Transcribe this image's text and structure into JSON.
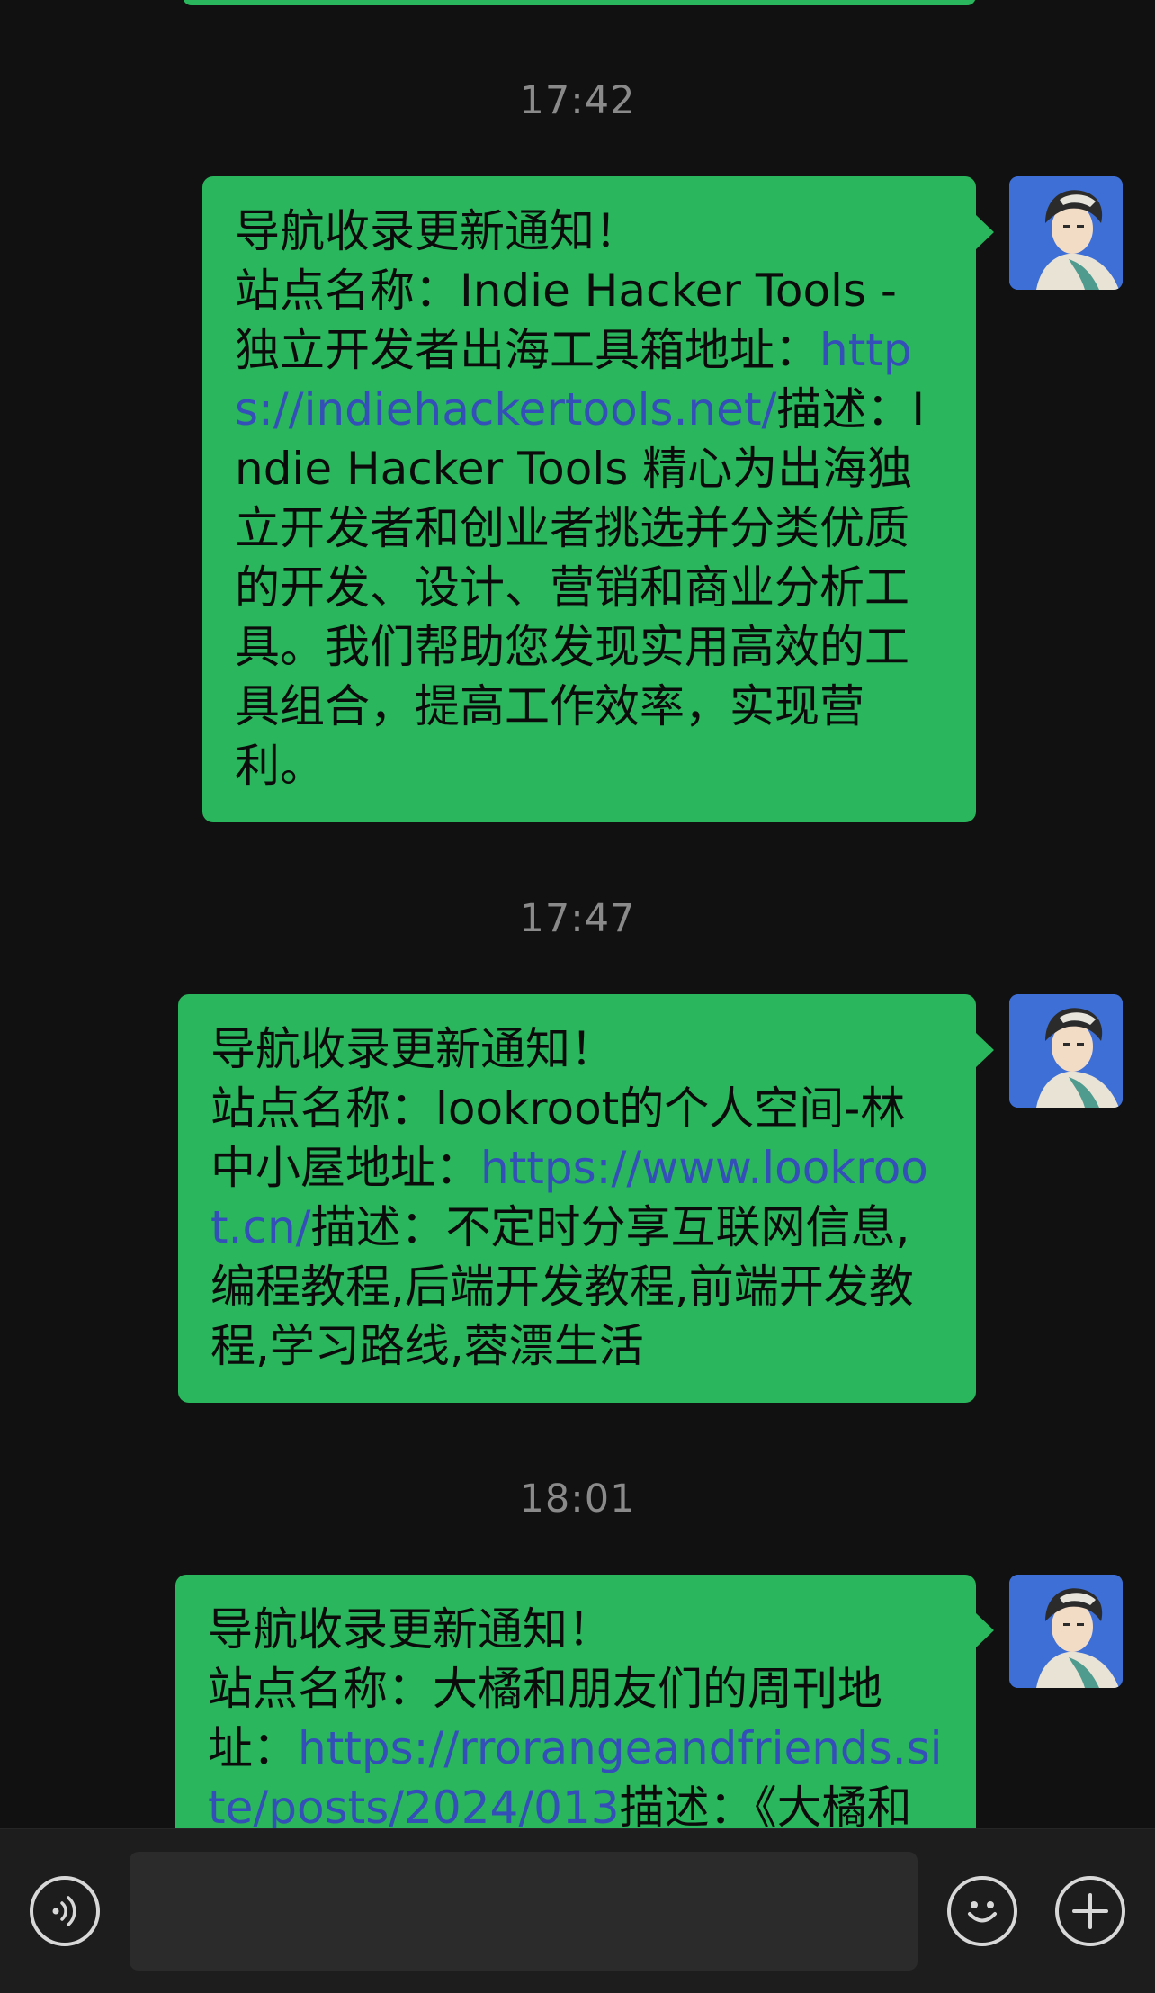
{
  "messages": [
    {
      "time": "17:42",
      "title": "导航收录更新通知！",
      "site_prefix": "站点名称：",
      "site_name": "Indie Hacker Tools - 独立开发者出海工具箱",
      "url_prefix": "地址：",
      "url": "https://indiehackertools.net/",
      "desc_prefix": "描述：",
      "desc": "Indie Hacker Tools 精心为出海独立开发者和创业者挑选并分类优质的开发、设计、营销和商业分析工具。我们帮助您发现实用高效的工具组合，提高工作效率，实现营利。"
    },
    {
      "time": "17:47",
      "title": "导航收录更新通知！",
      "site_prefix": "站点名称：",
      "site_name": "lookroot的个人空间-林中小屋",
      "url_prefix": "地址：",
      "url": "https://www.lookroot.cn/",
      "desc_prefix": "描述：",
      "desc": "不定时分享互联网信息,编程教程,后端开发教程,前端开发教程,学习路线,蓉漂生活"
    },
    {
      "time": "18:01",
      "title": "导航收录更新通知！",
      "site_prefix": "站点名称：",
      "site_name": "大橘和朋友们的周刊",
      "url_prefix": "地址：",
      "url": "https://rrorangeandfriends.site/posts/2024/013",
      "desc_prefix": "描述：",
      "desc": "《大橘和"
    }
  ],
  "input_bar": {
    "voice_icon": "voice-icon",
    "emoji_icon": "emoji-icon",
    "add_icon": "plus-icon",
    "input_value": ""
  },
  "colors": {
    "background": "#111111",
    "bubble": "#2ab65c",
    "link": "#3450b8",
    "timestamp": "#8a8a8a"
  }
}
